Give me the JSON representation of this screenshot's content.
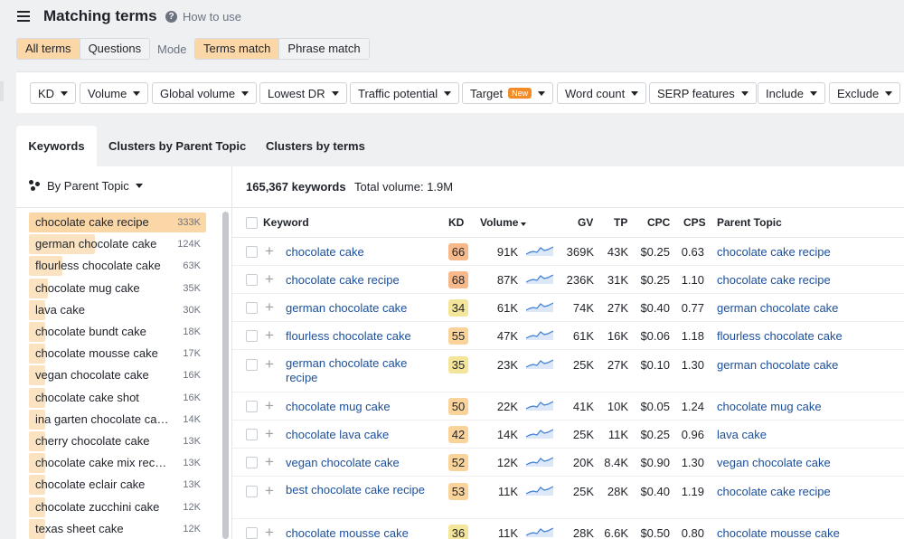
{
  "header": {
    "title": "Matching terms",
    "how_to_use": "How to use"
  },
  "toggles": {
    "type": [
      "All terms",
      "Questions"
    ],
    "mode_label": "Mode",
    "match": [
      "Terms match",
      "Phrase match"
    ]
  },
  "filters": [
    {
      "label": "KD"
    },
    {
      "label": "Volume"
    },
    {
      "label": "Global volume"
    },
    {
      "label": "Lowest DR"
    },
    {
      "label": "Traffic potential"
    },
    {
      "label": "Target",
      "badge": "New"
    },
    {
      "label": "Word count"
    },
    {
      "label": "SERP features"
    },
    {
      "label": "Include"
    },
    {
      "label": "Exclude"
    }
  ],
  "tabs": [
    "Keywords",
    "Clusters by Parent Topic",
    "Clusters by terms"
  ],
  "sidebar": {
    "group_by": "By Parent Topic",
    "items": [
      {
        "label": "chocolate cake recipe",
        "count": "333K"
      },
      {
        "label": "german chocolate cake",
        "count": "124K"
      },
      {
        "label": "flourless chocolate cake",
        "count": "63K"
      },
      {
        "label": "chocolate mug cake",
        "count": "35K"
      },
      {
        "label": "lava cake",
        "count": "30K"
      },
      {
        "label": "chocolate bundt cake",
        "count": "18K"
      },
      {
        "label": "chocolate mousse cake",
        "count": "17K"
      },
      {
        "label": "vegan chocolate cake",
        "count": "16K"
      },
      {
        "label": "chocolate cake shot",
        "count": "16K"
      },
      {
        "label": "ina garten chocolate cake",
        "count": "14K"
      },
      {
        "label": "cherry chocolate cake",
        "count": "13K"
      },
      {
        "label": "chocolate cake mix reci…",
        "count": "13K"
      },
      {
        "label": "chocolate eclair cake",
        "count": "13K"
      },
      {
        "label": "chocolate zucchini cake",
        "count": "12K"
      },
      {
        "label": "texas sheet cake",
        "count": "12K"
      }
    ]
  },
  "summary": {
    "keywords": "165,367 keywords",
    "total_volume": "Total volume: 1.9M"
  },
  "columns": {
    "keyword": "Keyword",
    "kd": "KD",
    "volume": "Volume",
    "gv": "GV",
    "tp": "TP",
    "cpc": "CPC",
    "cps": "CPS",
    "parent_topic": "Parent Topic"
  },
  "rows": [
    {
      "keyword": "chocolate cake",
      "kd": "66",
      "volume": "91K",
      "gv": "369K",
      "tp": "43K",
      "cpc": "$0.25",
      "cps": "0.63",
      "parent_topic": "chocolate cake recipe"
    },
    {
      "keyword": "chocolate cake recipe",
      "kd": "68",
      "volume": "87K",
      "gv": "236K",
      "tp": "31K",
      "cpc": "$0.25",
      "cps": "1.10",
      "parent_topic": "chocolate cake recipe"
    },
    {
      "keyword": "german chocolate cake",
      "kd": "34",
      "volume": "61K",
      "gv": "74K",
      "tp": "27K",
      "cpc": "$0.40",
      "cps": "0.77",
      "parent_topic": "german chocolate cake"
    },
    {
      "keyword": "flourless chocolate cake",
      "kd": "55",
      "volume": "47K",
      "gv": "61K",
      "tp": "16K",
      "cpc": "$0.06",
      "cps": "1.18",
      "parent_topic": "flourless chocolate cake"
    },
    {
      "keyword": "german chocolate cake recipe",
      "kd": "35",
      "volume": "23K",
      "gv": "25K",
      "tp": "27K",
      "cpc": "$0.10",
      "cps": "1.30",
      "parent_topic": "german chocolate cake"
    },
    {
      "keyword": "chocolate mug cake",
      "kd": "50",
      "volume": "22K",
      "gv": "41K",
      "tp": "10K",
      "cpc": "$0.05",
      "cps": "1.24",
      "parent_topic": "chocolate mug cake"
    },
    {
      "keyword": "chocolate lava cake",
      "kd": "42",
      "volume": "14K",
      "gv": "25K",
      "tp": "11K",
      "cpc": "$0.25",
      "cps": "0.96",
      "parent_topic": "lava cake"
    },
    {
      "keyword": "vegan chocolate cake",
      "kd": "52",
      "volume": "12K",
      "gv": "20K",
      "tp": "8.4K",
      "cpc": "$0.90",
      "cps": "1.30",
      "parent_topic": "vegan chocolate cake"
    },
    {
      "keyword": "best chocolate cake recipe",
      "kd": "53",
      "volume": "11K",
      "gv": "25K",
      "tp": "28K",
      "cpc": "$0.40",
      "cps": "1.19",
      "parent_topic": "chocolate cake recipe"
    },
    {
      "keyword": "chocolate mousse cake",
      "kd": "36",
      "volume": "11K",
      "gv": "28K",
      "tp": "6.6K",
      "cpc": "$0.50",
      "cps": "0.80",
      "parent_topic": "chocolate mousse cake"
    }
  ],
  "colors": {
    "kd_high": "#f7b98a",
    "kd_mid": "#fad39a",
    "kd_low": "#f3e59a",
    "highlight": "#fbd7a8",
    "link": "#1b4f9c"
  }
}
